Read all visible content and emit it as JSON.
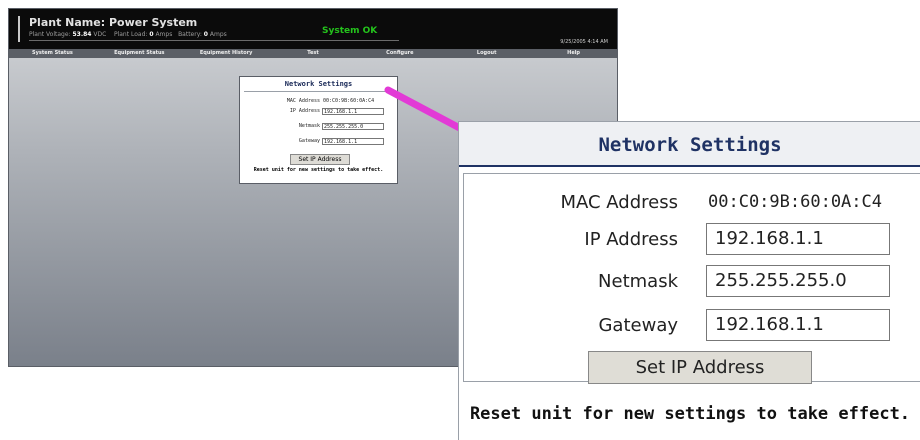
{
  "app": {
    "plant_name": "Plant Name:  Power System",
    "stats": {
      "plant_voltage_label": "Plant Voltage:",
      "plant_voltage_value": "53.84",
      "plant_voltage_unit": "VDC",
      "plant_load_label": "Plant Load:",
      "plant_load_value": "0",
      "plant_load_unit": "Amps",
      "battery_label": "Battery:",
      "battery_value": "0",
      "battery_unit": "Amps"
    },
    "status": "System OK",
    "timestamp": "9/25/2005 4:14 AM",
    "nav": [
      "System Status",
      "Equipment Status",
      "Equipment History",
      "Test",
      "Configure",
      "Logout",
      "Help"
    ]
  },
  "small_dialog": {
    "title": "Network Settings",
    "mac_label": "MAC Address",
    "mac_value": "00:C0:9B:60:0A:C4",
    "ip_label": "IP Address",
    "ip_value": "192.168.1.1",
    "netmask_label": "Netmask",
    "netmask_value": "255.255.255.0",
    "gateway_label": "Gateway",
    "gateway_value": "192.168.1.1",
    "button": "Set IP Address",
    "reset_note": "Reset unit for new settings to take effect."
  },
  "zoom": {
    "title": "Network Settings",
    "mac_label": "MAC Address",
    "mac_value": "00:C0:9B:60:0A:C4",
    "ip_label": "IP Address",
    "ip_value": "192.168.1.1",
    "netmask_label": "Netmask",
    "netmask_value": "255.255.255.0",
    "gateway_label": "Gateway",
    "gateway_value": "192.168.1.1",
    "button": "Set IP Address",
    "reset_note": "Reset unit for new settings to take effect."
  },
  "colors": {
    "status_ok": "#24c31c",
    "arrow": "#e23ad6",
    "title_blue": "#1f3264"
  }
}
